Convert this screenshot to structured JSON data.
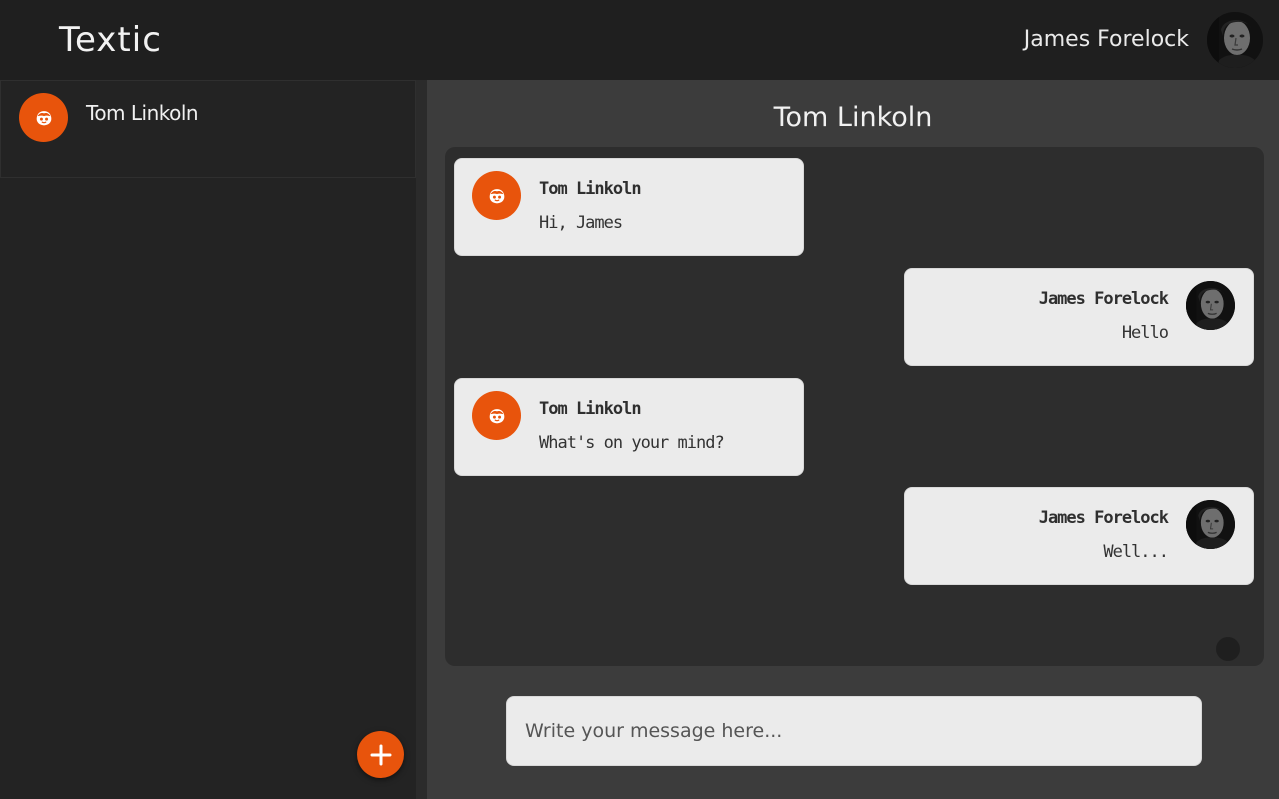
{
  "app": {
    "title": "Textic"
  },
  "user": {
    "name": "James Forelock"
  },
  "sidebar": {
    "contacts": [
      {
        "name": "Tom Linkoln"
      }
    ]
  },
  "chat": {
    "title": "Tom Linkoln",
    "messages": [
      {
        "sender": "Tom Linkoln",
        "text": "Hi, James",
        "direction": "incoming"
      },
      {
        "sender": "James Forelock",
        "text": "Hello",
        "direction": "outgoing"
      },
      {
        "sender": "Tom Linkoln",
        "text": "What's on your mind?",
        "direction": "incoming"
      },
      {
        "sender": "James Forelock",
        "text": "Well...",
        "direction": "outgoing"
      }
    ],
    "composer_placeholder": "Write your message here..."
  },
  "colors": {
    "accent": "#e8540c",
    "bubble": "#ebebeb",
    "panel": "#3c3c3c",
    "chat_bg": "#2d2d2d"
  }
}
